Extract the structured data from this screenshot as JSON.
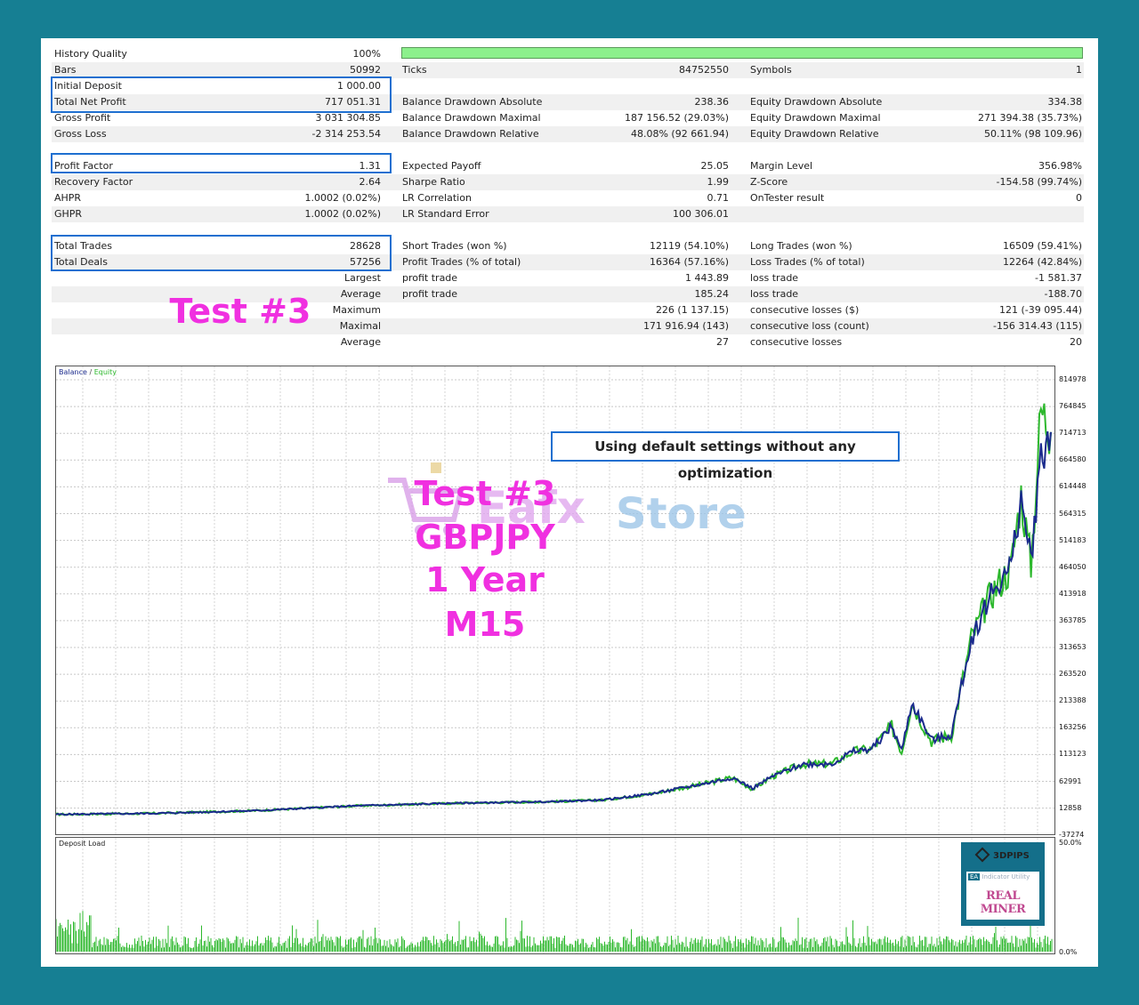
{
  "stats": {
    "col1": [
      {
        "label": "History Quality",
        "value": "100%"
      },
      {
        "label": "Bars",
        "value": "50992"
      },
      {
        "label": "Initial Deposit",
        "value": "1 000.00"
      },
      {
        "label": "Total Net Profit",
        "value": "717 051.31"
      },
      {
        "label": "Gross Profit",
        "value": "3 031 304.85"
      },
      {
        "label": "Gross Loss",
        "value": "-2 314 253.54"
      },
      {
        "label": "",
        "value": ""
      },
      {
        "label": "Profit Factor",
        "value": "1.31"
      },
      {
        "label": "Recovery Factor",
        "value": "2.64"
      },
      {
        "label": "AHPR",
        "value": "1.0002 (0.02%)"
      },
      {
        "label": "GHPR",
        "value": "1.0002 (0.02%)"
      },
      {
        "label": "",
        "value": ""
      },
      {
        "label": "Total Trades",
        "value": "28628"
      },
      {
        "label": "Total Deals",
        "value": "57256"
      },
      {
        "label": "Largest",
        "value": ""
      },
      {
        "label": "Average",
        "value": ""
      },
      {
        "label": "Maximum",
        "value": ""
      },
      {
        "label": "Maximal",
        "value": ""
      },
      {
        "label": "Average",
        "value": ""
      }
    ],
    "col2": [
      {
        "label": "",
        "value": ""
      },
      {
        "label": "Ticks",
        "value": "84752550"
      },
      {
        "label": "",
        "value": ""
      },
      {
        "label": "Balance Drawdown Absolute",
        "value": "238.36"
      },
      {
        "label": "Balance Drawdown Maximal",
        "value": "187 156.52 (29.03%)"
      },
      {
        "label": "Balance Drawdown Relative",
        "value": "48.08% (92 661.94)"
      },
      {
        "label": "",
        "value": ""
      },
      {
        "label": "Expected Payoff",
        "value": "25.05"
      },
      {
        "label": "Sharpe Ratio",
        "value": "1.99"
      },
      {
        "label": "LR Correlation",
        "value": "0.71"
      },
      {
        "label": "LR Standard Error",
        "value": "100 306.01"
      },
      {
        "label": "",
        "value": ""
      },
      {
        "label": "Short Trades (won %)",
        "value": "12119 (54.10%)"
      },
      {
        "label": "Profit Trades (% of total)",
        "value": "16364 (57.16%)"
      },
      {
        "label": "profit trade",
        "value": "1 443.89"
      },
      {
        "label": "profit trade",
        "value": "185.24"
      },
      {
        "label": "",
        "value": "226 (1 137.15)"
      },
      {
        "label": "",
        "value": "171 916.94 (143)"
      },
      {
        "label": "",
        "value": "27"
      }
    ],
    "col3": [
      {
        "label": "",
        "value": ""
      },
      {
        "label": "Symbols",
        "value": "1"
      },
      {
        "label": "",
        "value": ""
      },
      {
        "label": "Equity Drawdown Absolute",
        "value": "334.38"
      },
      {
        "label": "Equity Drawdown Maximal",
        "value": "271 394.38 (35.73%)"
      },
      {
        "label": "Equity Drawdown Relative",
        "value": "50.11% (98 109.96)"
      },
      {
        "label": "",
        "value": ""
      },
      {
        "label": "Margin Level",
        "value": "356.98%"
      },
      {
        "label": "Z-Score",
        "value": "-154.58 (99.74%)"
      },
      {
        "label": "OnTester result",
        "value": "0"
      },
      {
        "label": "",
        "value": ""
      },
      {
        "label": "",
        "value": ""
      },
      {
        "label": "Long Trades (won %)",
        "value": "16509 (59.41%)"
      },
      {
        "label": "Loss Trades (% of total)",
        "value": "12264 (42.84%)"
      },
      {
        "label": "loss trade",
        "value": "-1 581.37"
      },
      {
        "label": "loss trade",
        "value": "-188.70"
      },
      {
        "label": "consecutive losses ($)",
        "value": "121 (-39 095.44)"
      },
      {
        "label": "consecutive loss (count)",
        "value": "-156 314.43 (115)"
      },
      {
        "label": "consecutive losses",
        "value": "20"
      }
    ],
    "history_quality_pct": 100
  },
  "overlay": {
    "test_label": "Test #3",
    "note": "Using default settings without any optimization",
    "watermark_lines": [
      "Test #3",
      "GBPJPY",
      "1 Year",
      "M15"
    ],
    "store_word": "Store",
    "brand_logo_text": "Eafx"
  },
  "chart_data": [
    {
      "type": "line",
      "legend": [
        "Balance",
        "/",
        "Equity"
      ],
      "y_ticks": [
        "814978",
        "764845",
        "714713",
        "664580",
        "614448",
        "564315",
        "514183",
        "464050",
        "413918",
        "363785",
        "313653",
        "263520",
        "213388",
        "163256",
        "113123",
        "62991",
        "12858",
        "-37274"
      ],
      "ylim": [
        -37274,
        814978
      ],
      "x": [
        0,
        10,
        20,
        30,
        40,
        50,
        55,
        60,
        65,
        68,
        70,
        72,
        75,
        78,
        80,
        82,
        84,
        85,
        86,
        88,
        90,
        92,
        94,
        96,
        97,
        98,
        99,
        100
      ],
      "series": [
        {
          "name": "Balance",
          "values": [
            1000,
            3000,
            8000,
            17000,
            22000,
            25000,
            28000,
            40000,
            58000,
            70000,
            50000,
            72000,
            95000,
            96000,
            118000,
            124000,
            166000,
            120000,
            210000,
            140000,
            150000,
            330000,
            415000,
            465000,
            590000,
            480000,
            670000,
            717051
          ]
        },
        {
          "name": "Equity",
          "values": [
            1000,
            3000,
            8000,
            17000,
            22000,
            25000,
            28000,
            40000,
            58000,
            70000,
            48000,
            72000,
            95000,
            96000,
            118000,
            124000,
            166000,
            118000,
            210000,
            138000,
            150000,
            330000,
            415000,
            465000,
            600000,
            470000,
            760000,
            717051
          ]
        }
      ]
    },
    {
      "type": "bar",
      "title": "Deposit Load",
      "y_ticks": [
        "50.0%",
        "0.0%"
      ],
      "ylim": [
        0,
        50
      ]
    }
  ],
  "colors": {
    "frame": "#167f93",
    "balance": "#1a2a8c",
    "equity": "#2db82d",
    "highlight": "#1e6fd0",
    "magenta": "#f030e0",
    "quality_bar": "#8cf08c"
  },
  "badge": {
    "brand": "3DPIPS",
    "tags": [
      "EA",
      "Indicator",
      "Utility"
    ],
    "name": "REAL MINER"
  }
}
